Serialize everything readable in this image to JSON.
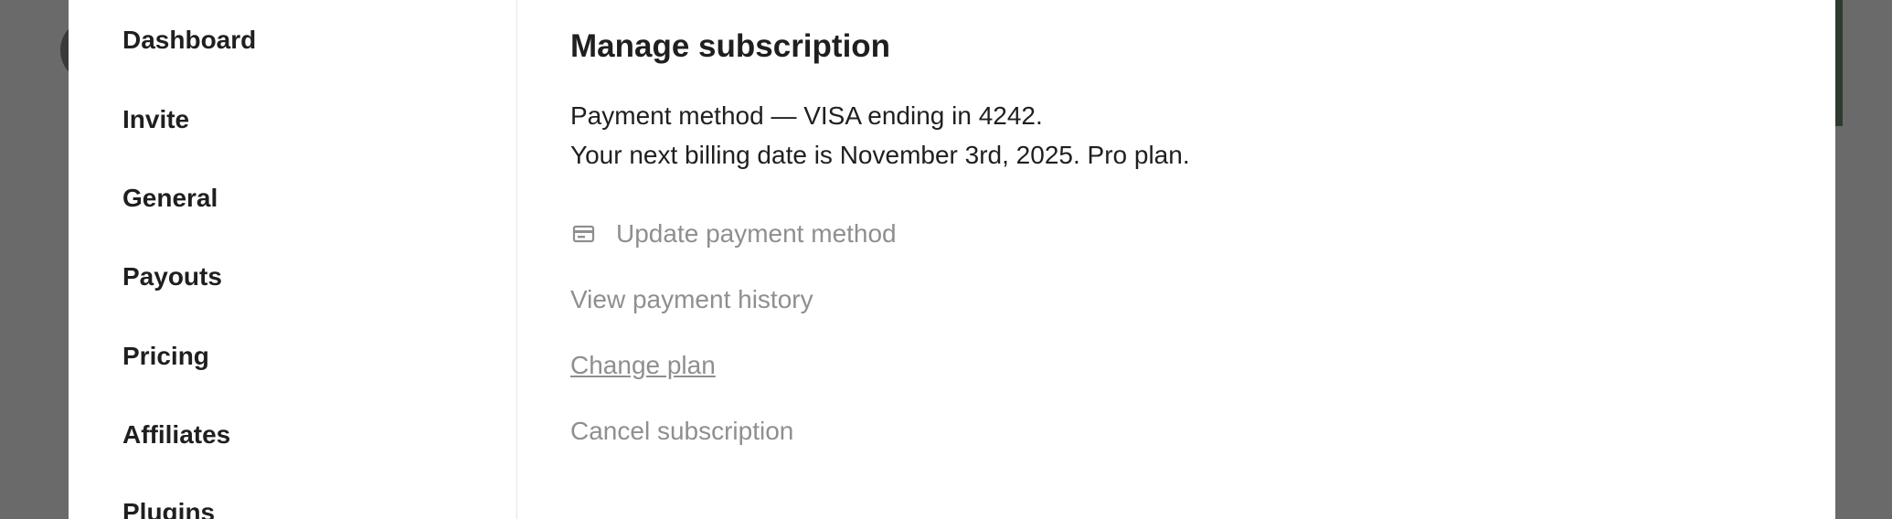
{
  "sidebar": {
    "items": [
      {
        "label": "Dashboard"
      },
      {
        "label": "Invite"
      },
      {
        "label": "General"
      },
      {
        "label": "Payouts"
      },
      {
        "label": "Pricing"
      },
      {
        "label": "Affiliates"
      },
      {
        "label": "Plugins"
      }
    ]
  },
  "main": {
    "title": "Manage subscription",
    "payment_method_line": "Payment method — VISA ending in 4242.",
    "billing_line": "Your next billing date is November 3rd, 2025. Pro plan.",
    "actions": {
      "update_payment": "Update payment method",
      "view_history": "View payment history",
      "change_plan": "Change plan",
      "cancel": "Cancel subscription"
    },
    "icons": {
      "update_payment_icon": "credit-card-icon"
    }
  },
  "colors": {
    "backdrop": "#6a6a6a",
    "modal_bg": "#ffffff",
    "text_primary": "#1f1f1f",
    "text_muted": "#8f8f8f",
    "divider": "#e6e6e6"
  }
}
